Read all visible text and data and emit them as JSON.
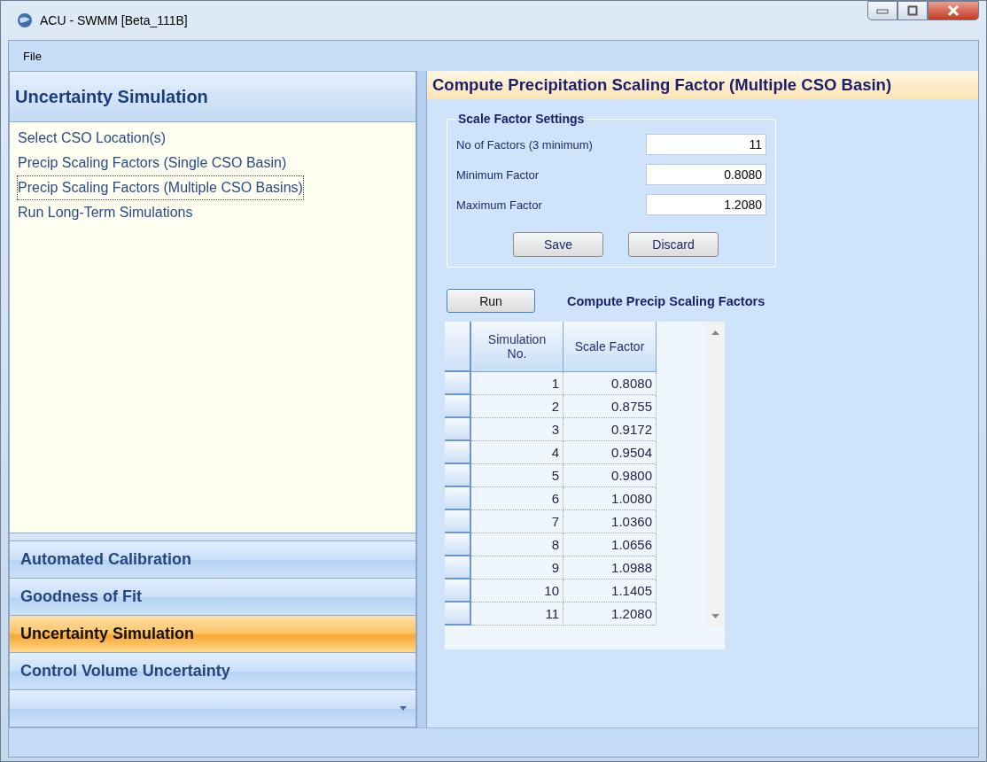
{
  "window": {
    "title": "ACU - SWMM [Beta_111B]"
  },
  "menu": [
    "File"
  ],
  "sidebar": {
    "title": "Uncertainty Simulation",
    "items": [
      {
        "label": "Select CSO Location(s)",
        "selected": false
      },
      {
        "label": "Precip Scaling Factors (Single CSO Basin)",
        "selected": false
      },
      {
        "label": "Precip Scaling Factors (Multiple CSO Basins)",
        "selected": true
      },
      {
        "label": "Run Long-Term Simulations",
        "selected": false
      }
    ],
    "sections": [
      {
        "label": "Automated Calibration",
        "selected": false
      },
      {
        "label": "Goodness of Fit",
        "selected": false
      },
      {
        "label": "Uncertainty Simulation",
        "selected": true
      },
      {
        "label": "Control Volume Uncertainty",
        "selected": false
      }
    ]
  },
  "panel": {
    "title": "Compute Precipitation Scaling Factor (Multiple CSO Basin)",
    "group": {
      "title": "Scale Factor Settings",
      "fields": [
        {
          "label": "No of Factors (3 minimum)",
          "value": "11"
        },
        {
          "label": "Minimum Factor",
          "value": "0.8080"
        },
        {
          "label": "Maximum Factor",
          "value": "1.2080"
        }
      ],
      "buttons": [
        "Save",
        "Discard"
      ]
    },
    "run_button": "Run",
    "run_label": "Compute Precip Scaling Factors",
    "table": {
      "columns": [
        "Simulation No.",
        "Scale Factor"
      ],
      "rows": [
        [
          "1",
          "0.8080"
        ],
        [
          "2",
          "0.8755"
        ],
        [
          "3",
          "0.9172"
        ],
        [
          "4",
          "0.9504"
        ],
        [
          "5",
          "0.9800"
        ],
        [
          "6",
          "1.0080"
        ],
        [
          "7",
          "1.0360"
        ],
        [
          "8",
          "1.0656"
        ],
        [
          "9",
          "1.0988"
        ],
        [
          "10",
          "1.1405"
        ],
        [
          "11",
          "1.2080"
        ]
      ]
    }
  }
}
